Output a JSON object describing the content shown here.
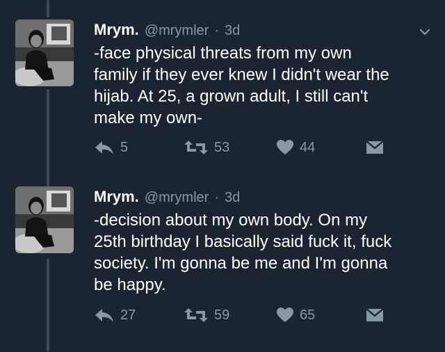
{
  "tweets": [
    {
      "name": "Mrym.",
      "handle": "@mrymler",
      "separator": "·",
      "time": "3d",
      "text": "-face physical threats from my own\nfamily if they ever knew I didn't wear the\nhijab. At 25, a grown adult, I still can't\nmake my own-",
      "reply_count": "5",
      "retweet_count": "53",
      "like_count": "44"
    },
    {
      "name": "Mrym.",
      "handle": "@mrymler",
      "separator": "·",
      "time": "3d",
      "text": "-decision about my own body. On my\n25th birthday I basically said fuck it, fuck\nsociety. I'm gonna be me and I'm gonna\nbe happy.",
      "reply_count": "27",
      "retweet_count": "59",
      "like_count": "65"
    }
  ],
  "icons": {
    "avatar": "profile-photo",
    "caret": "chevron-down-icon",
    "reply": "reply-icon",
    "retweet": "retweet-icon",
    "like": "heart-icon",
    "dm": "envelope-icon"
  },
  "colors": {
    "background": "#1b2532",
    "muted": "#8a97a5",
    "thread_line": "#3b4a59"
  }
}
